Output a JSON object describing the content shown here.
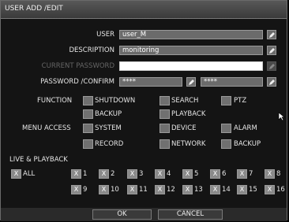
{
  "dialog": {
    "title": "USER ADD /EDIT"
  },
  "fields": {
    "user": {
      "label": "USER",
      "value": "user_M"
    },
    "description": {
      "label": "DESCRIPTION",
      "value": "monitoring"
    },
    "current_password": {
      "label": "CURRENT PASSWORD",
      "value": ""
    },
    "password": {
      "label": "PASSWORD /CONFIRM",
      "value": "****",
      "confirm": "****"
    }
  },
  "function": {
    "label": "FUNCTION",
    "options": [
      "SHUTDOWN",
      "SEARCH",
      "PTZ",
      "BACKUP",
      "PLAYBACK"
    ]
  },
  "menu_access": {
    "label": "MENU ACCESS",
    "options": [
      "SYSTEM",
      "DEVICE",
      "ALARM",
      "RECORD",
      "NETWORK",
      "BACKUP"
    ]
  },
  "live_playback": {
    "label": "LIVE & PLAYBACK",
    "all": {
      "label": "ALL",
      "mark": "X"
    },
    "channels": [
      "1",
      "2",
      "3",
      "4",
      "5",
      "6",
      "7",
      "8",
      "9",
      "10",
      "11",
      "12",
      "13",
      "14",
      "15",
      "16"
    ],
    "mark": "X"
  },
  "buttons": {
    "ok": "OK",
    "cancel": "CANCEL"
  },
  "icons": {
    "edit": "pencil-icon",
    "cursor": "mouse-pointer-icon"
  }
}
